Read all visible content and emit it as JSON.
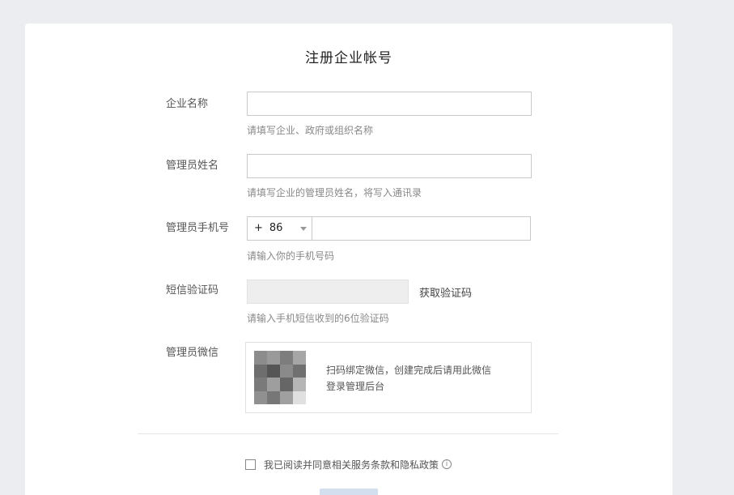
{
  "form": {
    "title": "注册企业帐号",
    "company": {
      "label": "企业名称",
      "value": "",
      "hint": "请填写企业、政府或组织名称"
    },
    "admin_name": {
      "label": "管理员姓名",
      "value": "",
      "hint": "请填写企业的管理员姓名，将写入通讯录"
    },
    "admin_phone": {
      "label": "管理员手机号",
      "country_plus": "+",
      "country_code": "86",
      "value": "",
      "hint": "请输入你的手机号码"
    },
    "sms": {
      "label": "短信验证码",
      "value": "",
      "button": "获取验证码",
      "hint": "请输入手机短信收到的6位验证码"
    },
    "wechat": {
      "label": "管理员微信",
      "qr_text_line1": "扫码绑定微信，创建完成后请用此微信",
      "qr_text_line2": "登录管理后台"
    },
    "agreement": {
      "text": "我已阅读并同意相关服务条款和隐私政策",
      "checked": false
    }
  },
  "icons": {
    "info": "info-icon",
    "dropdown": "chevron-down-icon",
    "checkbox": "checkbox-icon"
  },
  "colors": {
    "background": "#ebedf0",
    "card": "#ffffff",
    "submit_disabled": "#d3deef"
  }
}
